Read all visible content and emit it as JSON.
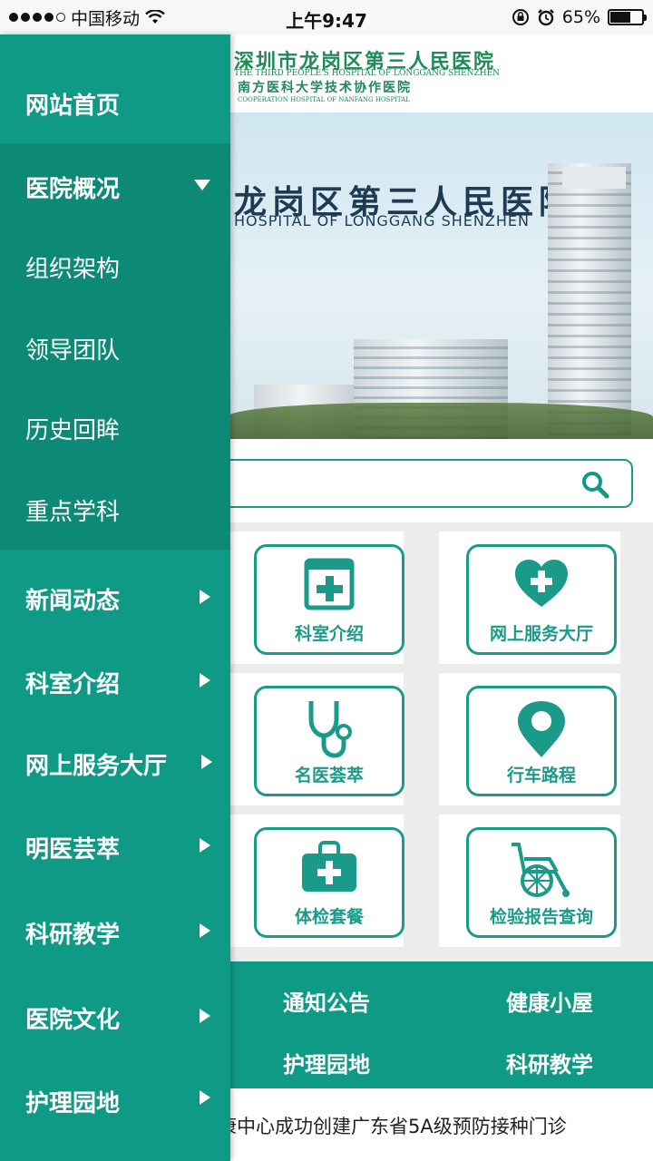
{
  "status_bar": {
    "carrier": "中国移动",
    "time": "上午9:47",
    "battery": "65%",
    "battery_level": 0.65
  },
  "header": {
    "logo_cn": "深圳市龙岗区第三人民医院",
    "logo_en": "THE THIRD PEOPLE'S HOSPITAL OF LONGGANG SHENZHEN",
    "logo_cn2": "南方医科大学技术协作医院",
    "logo_en2": "COOPERATION HOSPITAL OF NANFANG HOSPITAL"
  },
  "banner": {
    "title": "龙岗区第三人民医院",
    "subtitle": "HOSPITAL OF LONGGANG SHENZHEN"
  },
  "services": [
    {
      "label": "科室介绍",
      "icon": "first-aid-box-icon"
    },
    {
      "label": "网上服务大厅",
      "icon": "heart-plus-icon"
    },
    {
      "label": "名医荟萃",
      "icon": "stethoscope-icon"
    },
    {
      "label": "行车路程",
      "icon": "map-pin-icon"
    },
    {
      "label": "体检套餐",
      "icon": "medical-kit-icon"
    },
    {
      "label": "检验报告查询",
      "icon": "wheelchair-icon"
    }
  ],
  "quick_links": [
    "通知公告",
    "健康小屋",
    "护理园地",
    "科研教学"
  ],
  "ticker": "康中心成功创建广东省5A级预防接种门诊",
  "drawer": {
    "home": "网站首页",
    "overview": {
      "label": "医院概况",
      "children": [
        "组织架构",
        "领导团队",
        "历史回眸",
        "重点学科"
      ]
    },
    "items": [
      "新闻动态",
      "科室介绍",
      "网上服务大厅",
      "明医芸萃",
      "科研教学",
      "医院文化",
      "护理园地"
    ]
  },
  "colors": {
    "accent": "#0f9a86",
    "accent_dark": "#0c8a76"
  }
}
